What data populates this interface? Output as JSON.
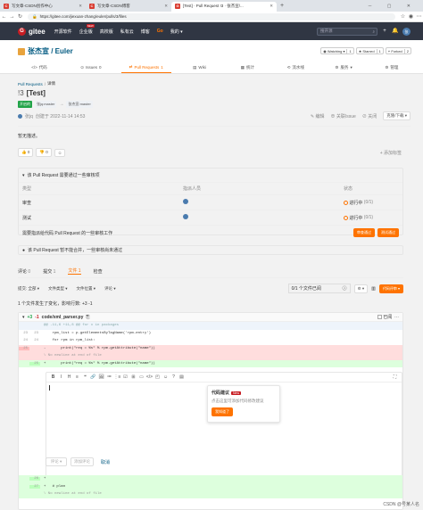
{
  "browser": {
    "tabs": [
      {
        "label": "写文章-CSDN创作中心",
        "active": false
      },
      {
        "label": "写文章-CSDN博客",
        "active": false
      },
      {
        "label": "[Test] · Pull Request !3 · 张杰宣/...",
        "active": true
      }
    ],
    "url": "https://gitee.com/jiexuan-zhang/euler/pulls/3/files"
  },
  "header": {
    "logo_letter": "G",
    "logo_text": "gitee",
    "nav": [
      "开源软件",
      "企业版",
      "高校版",
      "私有云",
      "博客"
    ],
    "nav_badge": "NEW",
    "go": "Go",
    "mine": "我的",
    "search_placeholder": "搜开源"
  },
  "repo": {
    "owner": "张杰宣",
    "sep": " / ",
    "name": "Euler",
    "watching": {
      "label": "Watching",
      "count": "1"
    },
    "starred": {
      "label": "Starred",
      "count": "1"
    },
    "forked": {
      "label": "Forked",
      "count": "2"
    },
    "tabs": [
      {
        "label": "代码",
        "active": false
      },
      {
        "label": "Issues",
        "count": "0",
        "active": false
      },
      {
        "label": "Pull Requests",
        "count": "1",
        "active": true
      },
      {
        "label": "Wiki",
        "active": false
      },
      {
        "label": "统计",
        "active": false
      },
      {
        "label": "流水线",
        "active": false
      },
      {
        "label": "服务",
        "active": false
      },
      {
        "label": "管理",
        "active": false
      }
    ]
  },
  "pr": {
    "breadcrumb": [
      "Pull Requests",
      "/",
      "详情"
    ],
    "number": "!3",
    "title": "[Test]",
    "status": "开启的",
    "branch_from": "张jq:master",
    "arrow": "→",
    "branch_to": "张杰宣:master",
    "author": "张jq",
    "created": "创建于 2022-11-14 14:53",
    "actions": [
      "编辑",
      "关联Issue",
      "关闭"
    ],
    "download": "克隆/下载",
    "description": "暂无描述。",
    "reactions": [
      "👍 0",
      "👎 0"
    ],
    "add_tag": "+ 添加标签"
  },
  "review": {
    "heading": "该 Pull Request 需要通过一些审核项",
    "columns": [
      "类型",
      "指派人员",
      "状态"
    ],
    "rows": [
      {
        "type": "审查",
        "status": "进行中",
        "count": "(0/1)"
      },
      {
        "type": "测试",
        "status": "进行中",
        "count": "(0/1)"
      }
    ],
    "footer": "需要指派给代码 Pull Request 的一些审核工作",
    "btn_review": "审查通过",
    "btn_test": "测试通过",
    "warn": "该 Pull Request 暂不能合并，一些审核尚未通过"
  },
  "files": {
    "tabs": [
      {
        "label": "评论",
        "count": "0"
      },
      {
        "label": "提交",
        "count": "1"
      },
      {
        "label": "文件",
        "count": "1"
      },
      {
        "label": "检查",
        "count": ""
      }
    ],
    "filters": [
      "提交: 全部",
      "文件类型",
      "文件位置",
      "评论"
    ],
    "viewed": "0/1 个文件已阅",
    "code_review_btn": "代码评审",
    "summary": "1 个文件发生了变化，影响行数: +3 -1",
    "file": {
      "add": "+3",
      "del": "-1",
      "name": "code/xml_parser.py",
      "viewed": "已阅"
    },
    "lines": [
      {
        "kind": "hunk",
        "old": "",
        "new": "",
        "text": "@@ -11,6 +11,8 @@ for x in packages"
      },
      {
        "kind": "ctx",
        "old": "23",
        "new": "23",
        "text": "    rpm_list = p.getElementsByTagName('rpm-entry')"
      },
      {
        "kind": "ctx",
        "old": "24",
        "new": "24",
        "text": "    for rpm in rpm_list:"
      },
      {
        "kind": "del",
        "old": "25",
        "new": "",
        "text": "-       print(\"req = %s\" % rpm.getAttribute(\"name\"))"
      },
      {
        "kind": "nonl",
        "old": "",
        "new": "",
        "text": "\\ No newline at end of file"
      },
      {
        "kind": "add",
        "old": "",
        "new": "25",
        "text": "+       print(\"req = %s\" % rpm.getAttribute(\"name\"))"
      }
    ],
    "tail_lines": [
      {
        "kind": "add",
        "old": "",
        "new": "26",
        "text": "+"
      },
      {
        "kind": "add",
        "old": "",
        "new": "27",
        "text": "+   # plan"
      },
      {
        "kind": "nonl",
        "old": "",
        "new": "",
        "text": "\\ No newline at end of file"
      }
    ]
  },
  "editor": {
    "tools": [
      "B",
      "I",
      "H",
      "≡",
      "❝",
      "🔗",
      "🖼",
      "≔",
      "⋮≡",
      "☑",
      "⊞",
      "▭",
      "</>",
      "◰",
      "☺",
      "?",
      "▤"
    ],
    "popup_title": "代码建议",
    "popup_tag": "New",
    "popup_text": "点击这里可添加代码修改建议",
    "popup_btn": "我知道了",
    "btn_comment": "评论",
    "btn_later": "添加评论",
    "btn_cancel": "取消"
  },
  "watermark": "CSDN @号某人名"
}
